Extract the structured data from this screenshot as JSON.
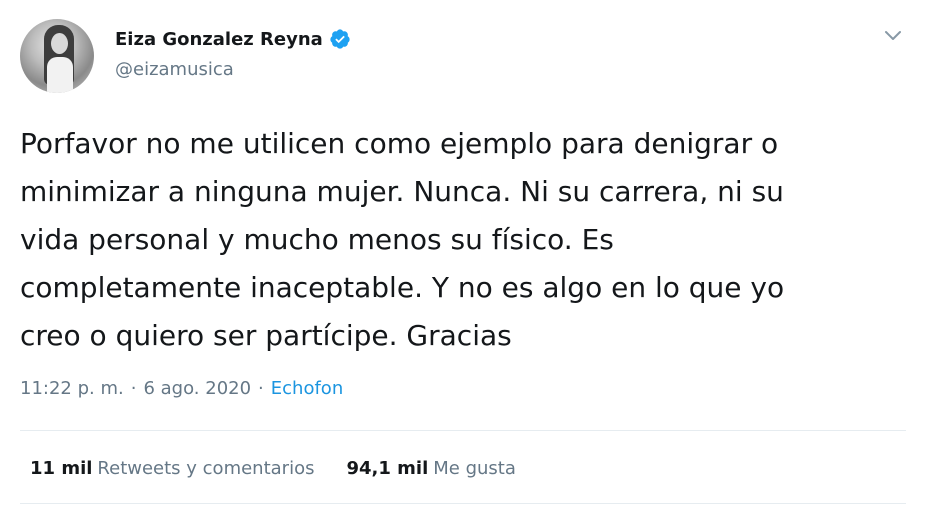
{
  "author": {
    "display_name": "Eiza Gonzalez Reyna",
    "handle": "@eizamusica",
    "verified": true
  },
  "tweet": {
    "lines": [
      "Porfavor no me utilicen como ejemplo para denigrar o",
      "minimizar a ninguna mujer. Nunca. Ni su carrera, ni su",
      "vida personal y mucho menos su físico. Es",
      "completamente inaceptable. Y no es algo en lo que yo",
      "creo o quiero ser partícipe. Gracias"
    ]
  },
  "meta": {
    "time": "11:22 p. m.",
    "separator": "·",
    "date": "6 ago. 2020",
    "source": "Echofon"
  },
  "stats": {
    "retweets_count": "11 mil",
    "retweets_label": "Retweets y comentarios",
    "likes_count": "94,1 mil",
    "likes_label": "Me gusta"
  },
  "icons": {
    "verified": "verified-badge-icon",
    "caret": "chevron-down-icon"
  },
  "colors": {
    "link": "#1b95e0",
    "secondary_text": "#657786",
    "primary_text": "#14171a",
    "divider": "#e6ecf0"
  }
}
